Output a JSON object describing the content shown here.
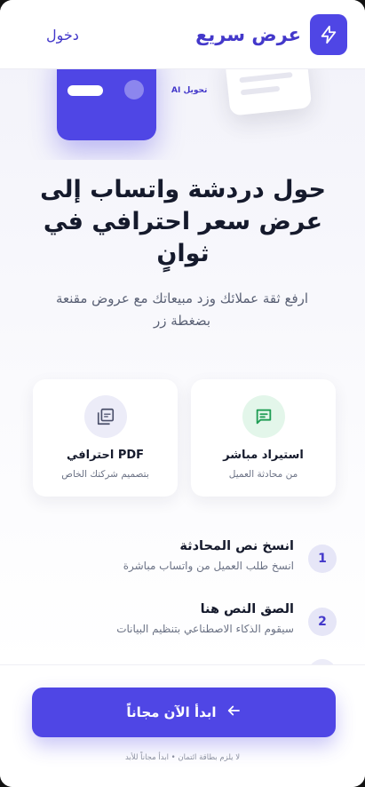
{
  "header": {
    "brand_name": "عرض سريع",
    "brand_icon": "lightning-bolt-icon",
    "login_label": "دخول"
  },
  "hero": {
    "ai_label": "AI تحويل"
  },
  "main": {
    "title": "حول دردشة واتساب إلى عرض سعر احترافي في ثوانٍ",
    "subtitle": "ارفع ثقة عملائك وزد مبيعاتك مع عروض مقنعة بضغطة زر"
  },
  "features": [
    {
      "icon": "message-icon",
      "title": "استيراد مباشر",
      "desc": "من محادثة العميل"
    },
    {
      "icon": "pdf-icon",
      "title": "PDF احترافي",
      "desc": "بتصميم شركتك الخاص"
    }
  ],
  "steps": [
    {
      "num": "1",
      "title": "انسخ نص المحادثة",
      "desc": "انسخ طلب العميل من واتساب مباشرة"
    },
    {
      "num": "2",
      "title": "الصق النص هنا",
      "desc": "سيقوم الذكاء الاصطناعي بتنظيم البيانات"
    }
  ],
  "cta": {
    "label": "ابدأ الآن مجاناً",
    "icon": "arrow-left-icon",
    "footnote": "لا يلزم بطاقة ائتمان • ابدأ مجاناً للأبد"
  },
  "colors": {
    "accent": "#4f46e5",
    "accent_dark": "#4338ca",
    "green_bg": "#e3f6ea",
    "green_icon": "#1f9d55",
    "purple_bg": "#ececf8"
  }
}
